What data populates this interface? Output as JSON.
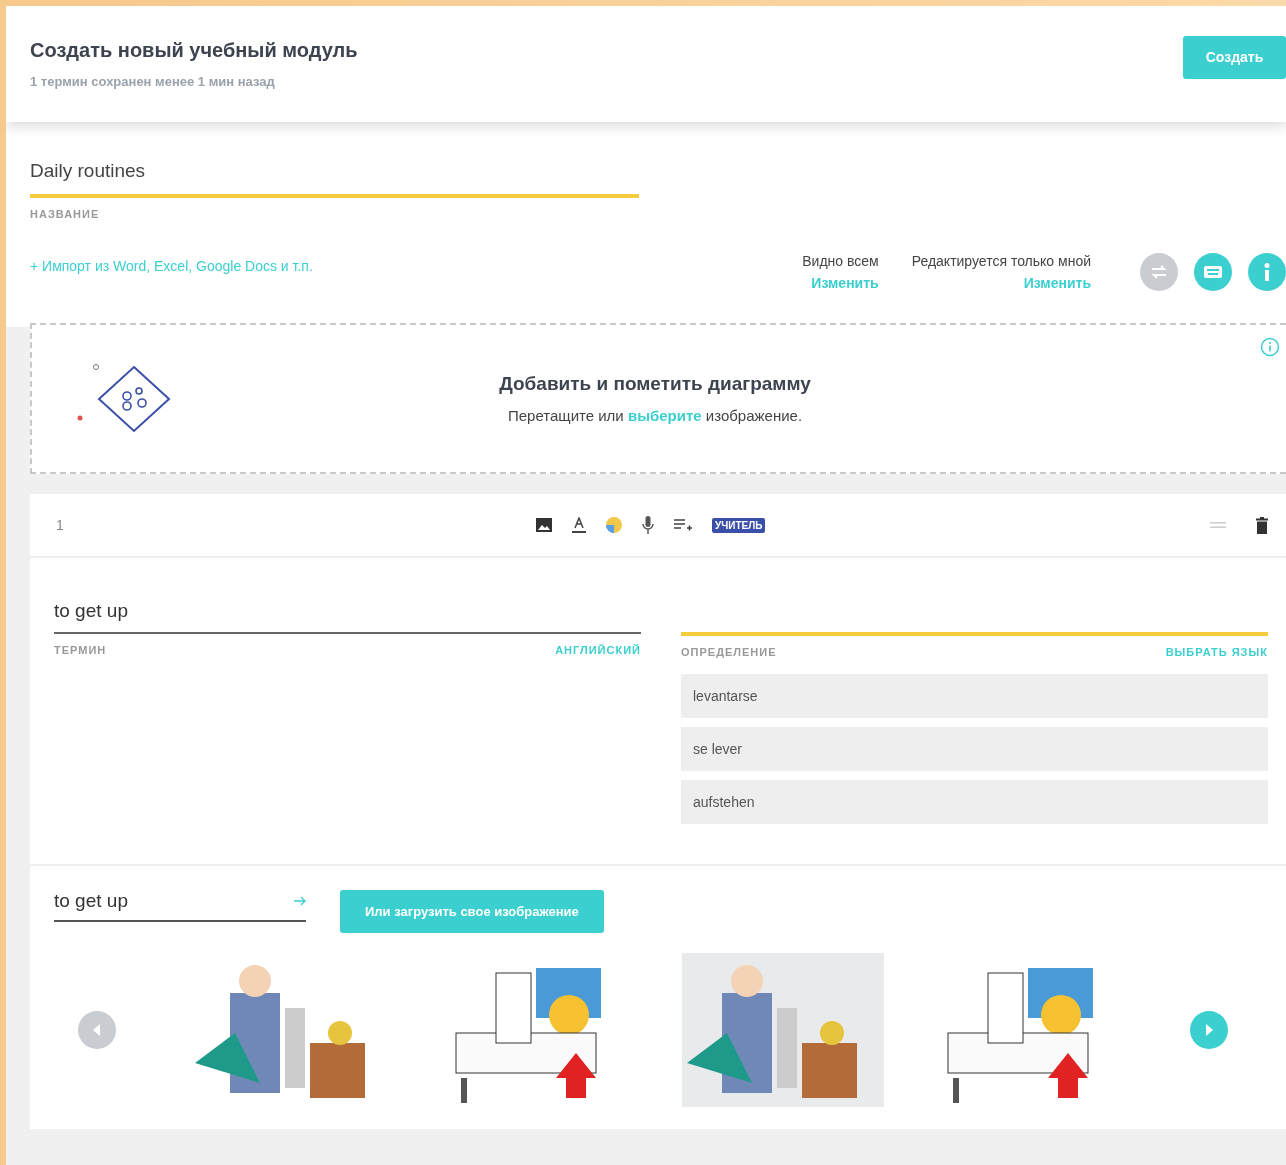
{
  "header": {
    "title": "Создать новый учебный модуль",
    "status": "1 термин сохранен менее 1 мин назад",
    "create_button": "Создать"
  },
  "set_title": {
    "value": "Daily routines",
    "label": "НАЗВАНИЕ"
  },
  "import_link": "+ Импорт из Word, Excel, Google Docs и т.п.",
  "permissions": [
    {
      "label": "Видно всем",
      "action": "Изменить"
    },
    {
      "label": "Редактируется только мной",
      "action": "Изменить"
    }
  ],
  "tool_buttons": [
    {
      "kind": "swap",
      "disabled": true
    },
    {
      "kind": "keyboard",
      "disabled": false
    },
    {
      "kind": "info",
      "disabled": false
    }
  ],
  "diagram": {
    "title": "Добавить и пометить диаграмму",
    "hint": "Перетащите или **выберите** изображение."
  },
  "card": {
    "number": "1",
    "badge": "УЧИТЕЛЬ",
    "term": {
      "value": "to get up",
      "label": "ТЕРМИН",
      "language": "АНГЛИЙСКИЙ"
    },
    "definition": {
      "label": "ОПРЕДЕЛЕНИЕ",
      "language": "ВЫБРАТЬ ЯЗЫК",
      "focused": true
    },
    "suggestions": [
      "levantarse",
      "se lever",
      "aufstehen"
    ],
    "image_search": {
      "value": "to get up",
      "upload_button": "Или загрузить свое изображение"
    },
    "carousel": {
      "prev_disabled": true,
      "next_disabled": false
    },
    "images": [
      {
        "kind": "picture"
      },
      {
        "kind": "picture"
      },
      {
        "kind": "picture"
      },
      {
        "kind": "picture"
      }
    ]
  }
}
